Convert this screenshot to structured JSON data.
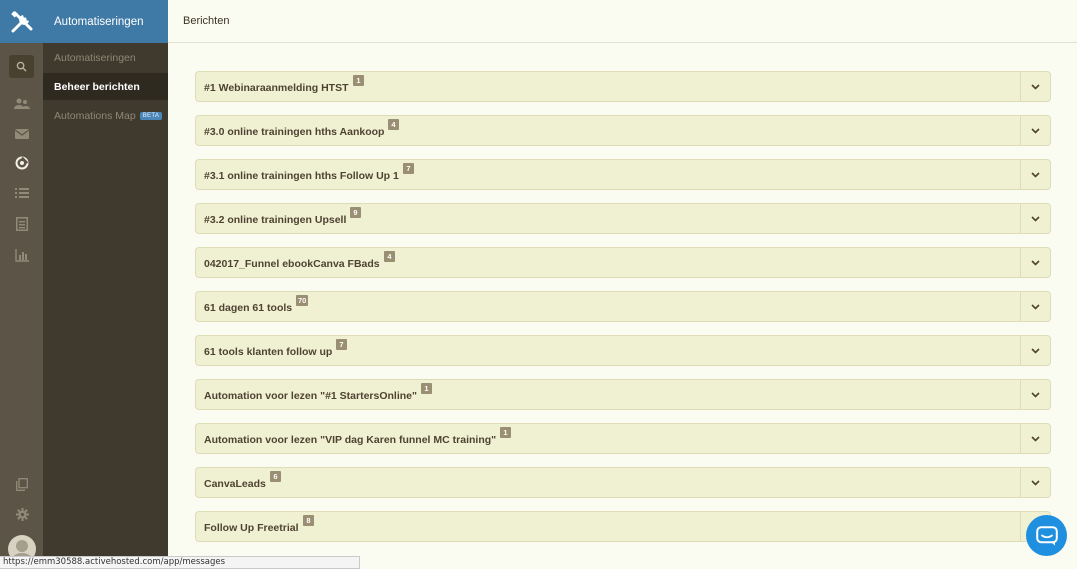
{
  "subnav": {
    "header": "Automatiseringen",
    "items": [
      {
        "label": "Automatiseringen"
      },
      {
        "label": "Beheer berichten"
      },
      {
        "label": "Automations Map",
        "badge": "BETA"
      }
    ]
  },
  "topbar": {
    "title": "Berichten"
  },
  "rail": {
    "icons": [
      "tools-logo-icon",
      "search-icon",
      "contacts-icon",
      "mail-icon",
      "automation-icon",
      "list-icon",
      "forms-icon",
      "reports-icon",
      "pages-icon",
      "settings-icon",
      "avatar"
    ]
  },
  "automations": [
    {
      "name": "#1 Webinaraanmelding HTST",
      "count": "1"
    },
    {
      "name": "#3.0 online trainingen hths Aankoop",
      "count": "4"
    },
    {
      "name": "#3.1 online trainingen hths Follow Up 1",
      "count": "7"
    },
    {
      "name": "#3.2 online trainingen Upsell",
      "count": "9"
    },
    {
      "name": "042017_Funnel ebookCanva FBads",
      "count": "4"
    },
    {
      "name": "61 dagen 61 tools",
      "count": "70"
    },
    {
      "name": "61 tools klanten follow up",
      "count": "7"
    },
    {
      "name": "Automation voor lezen \"#1 StartersOnline\"",
      "count": "1"
    },
    {
      "name": "Automation voor lezen \"VIP dag Karen funnel MC training\"",
      "count": "1"
    },
    {
      "name": "CanvaLeads",
      "count": "6"
    },
    {
      "name": "Follow Up Freetrial",
      "count": "8"
    }
  ],
  "statusbar": {
    "url": "https://emm30588.activehosted.com/app/messages"
  },
  "colors": {
    "accent": "#3f7aa6",
    "rail": "#5c5446",
    "subnav": "#40392d",
    "row_bg": "#f0f0d3",
    "badge": "#9a8e73",
    "chat": "#1f8fe0"
  }
}
